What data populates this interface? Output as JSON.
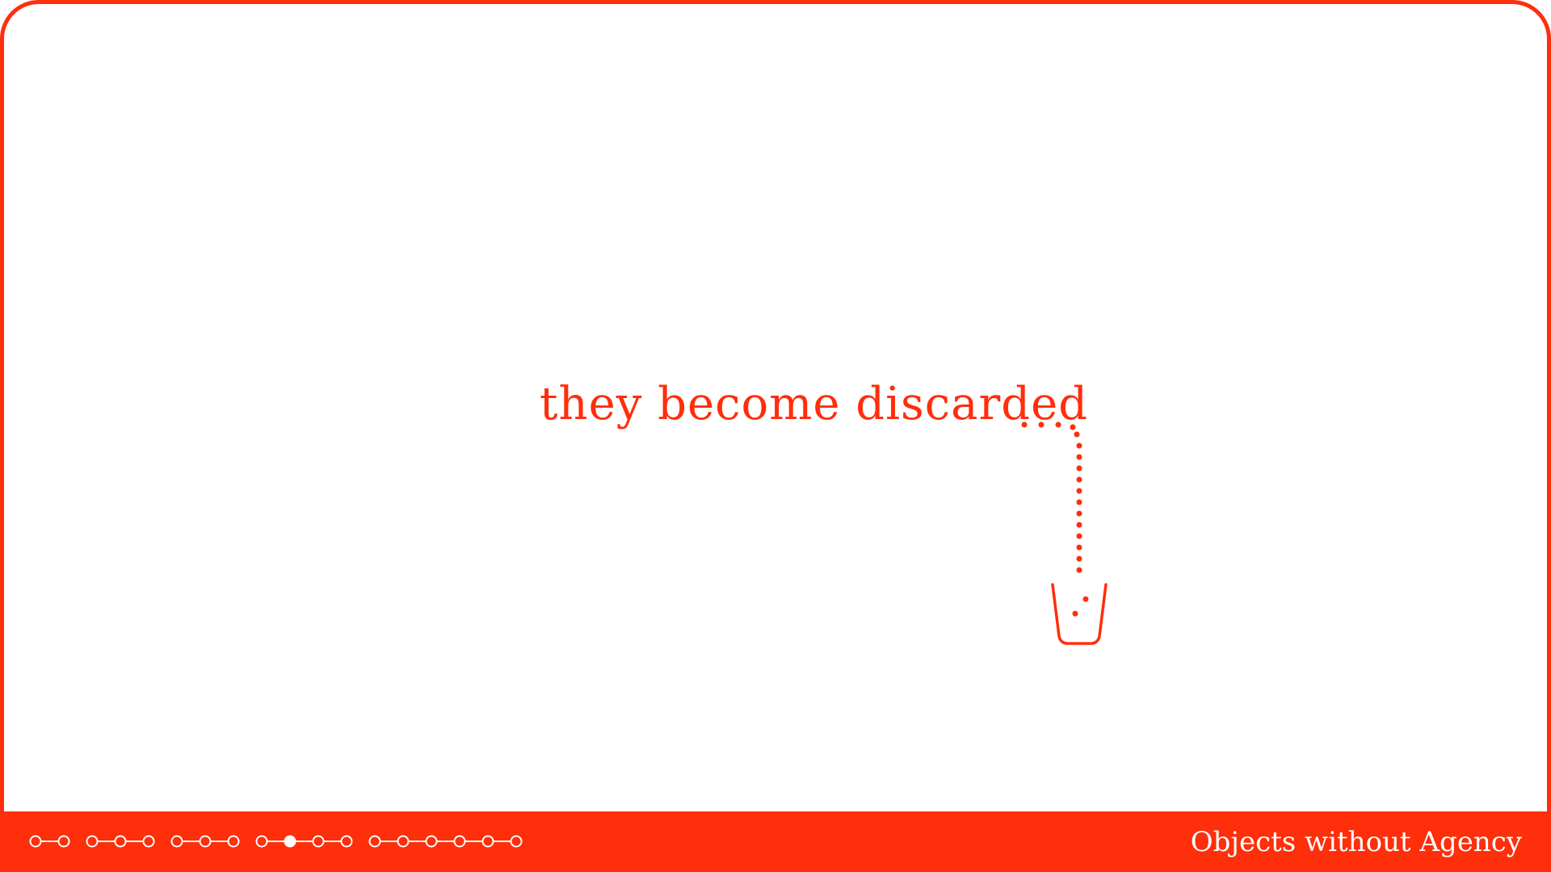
{
  "slide": {
    "headline": "they become discarded",
    "ellipsis": "...",
    "footer_title": "Objects without Agency",
    "illustration": "trash-bin-icon"
  },
  "progress": {
    "groups": [
      2,
      3,
      3,
      4,
      6
    ],
    "current_group": 3,
    "current_index": 1
  },
  "colors": {
    "accent": "#ff2e0b",
    "background": "#ffffff",
    "footer_text": "#ffffff"
  }
}
